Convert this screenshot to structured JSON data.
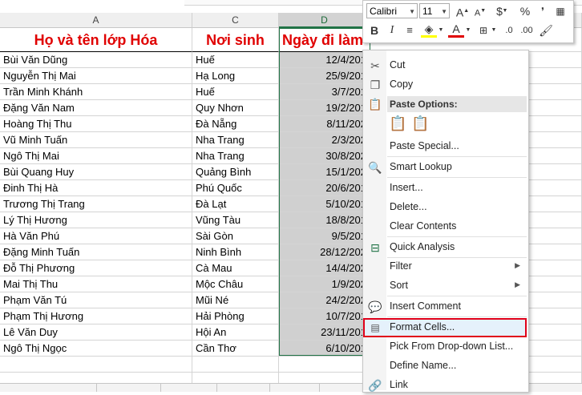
{
  "columns": [
    "A",
    "C",
    "D"
  ],
  "header": {
    "name": "Họ và tên lớp Hóa",
    "place": "Nơi sinh",
    "date": "Ngày đi làm"
  },
  "rows": [
    {
      "name": "Bùi Văn Dũng",
      "place": "Huế",
      "date": "12/4/201"
    },
    {
      "name": "Nguyễn Thị Mai",
      "place": "Hạ Long",
      "date": "25/9/201"
    },
    {
      "name": "Trần Minh Khánh",
      "place": "Huế",
      "date": "3/7/201"
    },
    {
      "name": "Đặng Văn Nam",
      "place": "Quy Nhơn",
      "date": "19/2/201"
    },
    {
      "name": "Hoàng Thị Thu",
      "place": "Đà Nẵng",
      "date": "8/11/202"
    },
    {
      "name": "Vũ Minh Tuấn",
      "place": "Nha Trang",
      "date": "2/3/202"
    },
    {
      "name": "Ngô Thị Mai",
      "place": "Nha Trang",
      "date": "30/8/202"
    },
    {
      "name": "Bùi Quang Huy",
      "place": "Quảng Bình",
      "date": "15/1/202"
    },
    {
      "name": "Đinh Thị Hà",
      "place": "Phú Quốc",
      "date": "20/6/201"
    },
    {
      "name": "Trương Thị Trang",
      "place": "Đà Lạt",
      "date": "5/10/201"
    },
    {
      "name": "Lý Thị Hương",
      "place": "Vũng Tàu",
      "date": "18/8/201"
    },
    {
      "name": "Hà Văn Phú",
      "place": "Sài Gòn",
      "date": "9/5/201"
    },
    {
      "name": "Đặng Minh Tuấn",
      "place": "Ninh Bình",
      "date": "28/12/202"
    },
    {
      "name": "Đỗ Thị Phương",
      "place": "Cà Mau",
      "date": "14/4/202"
    },
    {
      "name": "Mai Thị Thu",
      "place": "Mộc Châu",
      "date": "1/9/202"
    },
    {
      "name": "Phạm Văn Tú",
      "place": "Mũi Né",
      "date": "24/2/202"
    },
    {
      "name": "Phạm Thị Hương",
      "place": "Hải Phòng",
      "date": "10/7/201"
    },
    {
      "name": "Lê Văn Duy",
      "place": "Hội An",
      "date": "23/11/201"
    },
    {
      "name": "Ngô Thị Ngọc",
      "place": "Cần Thơ",
      "date": "6/10/201"
    }
  ],
  "toolbar": {
    "font": "Calibri",
    "size": "11"
  },
  "menu": {
    "cut": "Cut",
    "copy": "Copy",
    "paste_options": "Paste Options:",
    "paste_special": "Paste Special...",
    "smart_lookup": "Smart Lookup",
    "insert": "Insert...",
    "delete": "Delete...",
    "clear_contents": "Clear Contents",
    "quick_analysis": "Quick Analysis",
    "filter": "Filter",
    "sort": "Sort",
    "insert_comment": "Insert Comment",
    "format_cells": "Format Cells...",
    "pick_dropdown": "Pick From Drop-down List...",
    "define_name": "Define Name...",
    "link": "Link"
  },
  "colors": {
    "header_text": "#e00000",
    "selection_border": "#217346",
    "highlight_border": "#e0001a",
    "font_color": "#e00000",
    "fill_color": "#ffff00"
  }
}
